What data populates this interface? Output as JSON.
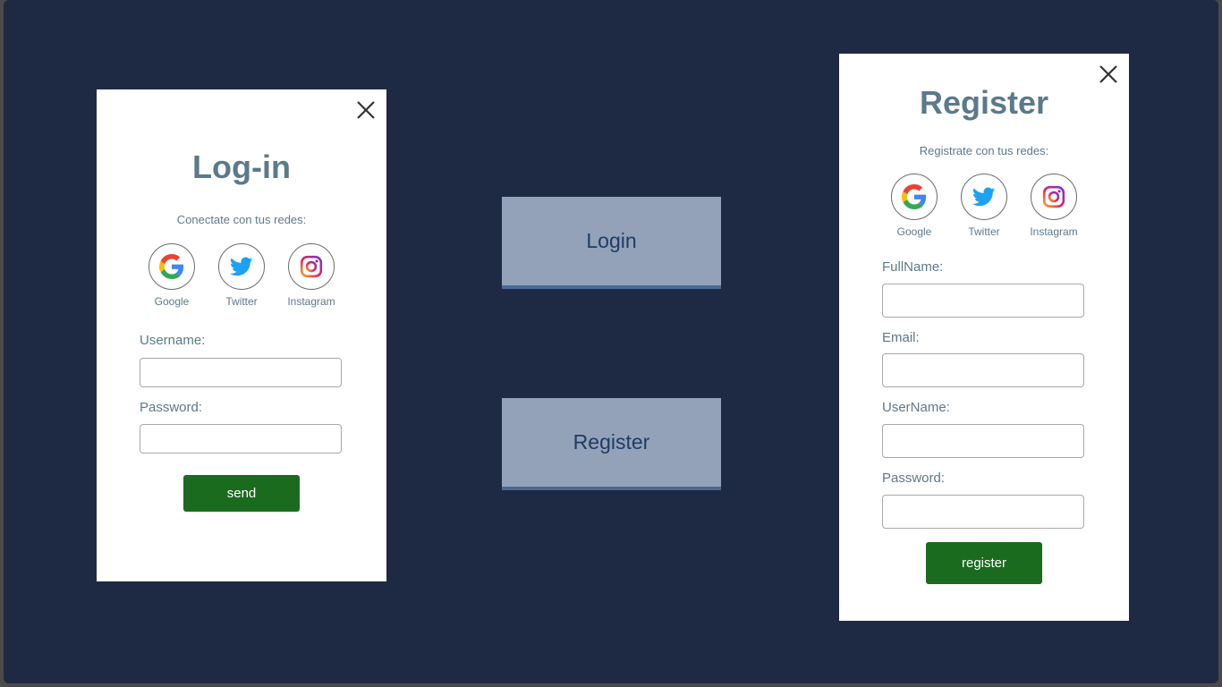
{
  "login_panel": {
    "title": "Log-in",
    "subtitle": "Conectate con tus redes:",
    "socials": [
      {
        "label": "Google",
        "icon": "google-icon"
      },
      {
        "label": "Twitter",
        "icon": "twitter-icon"
      },
      {
        "label": "Instagram",
        "icon": "instagram-icon"
      }
    ],
    "fields": [
      {
        "label": "Username:",
        "value": "",
        "placeholder": ""
      },
      {
        "label": "Password:",
        "value": "",
        "placeholder": ""
      }
    ],
    "submit_label": "send"
  },
  "center": {
    "login_label": "Login",
    "register_label": "Register"
  },
  "register_panel": {
    "title": "Register",
    "subtitle": "Registrate con tus redes:",
    "socials": [
      {
        "label": "Google",
        "icon": "google-icon"
      },
      {
        "label": "Twitter",
        "icon": "twitter-icon"
      },
      {
        "label": "Instagram",
        "icon": "instagram-icon"
      }
    ],
    "fields": [
      {
        "label": "FullName:",
        "value": "",
        "placeholder": ""
      },
      {
        "label": "Email:",
        "value": "",
        "placeholder": ""
      },
      {
        "label": "UserName:",
        "value": "",
        "placeholder": ""
      },
      {
        "label": "Password:",
        "value": "",
        "placeholder": ""
      }
    ],
    "submit_label": "register"
  },
  "colors": {
    "background": "#1e2a44",
    "title": "#5b7a8c",
    "submit": "#1b6b1f",
    "center_button": "#93a2b8",
    "center_button_text": "#1f3c66",
    "twitter": "#1da1f2"
  }
}
